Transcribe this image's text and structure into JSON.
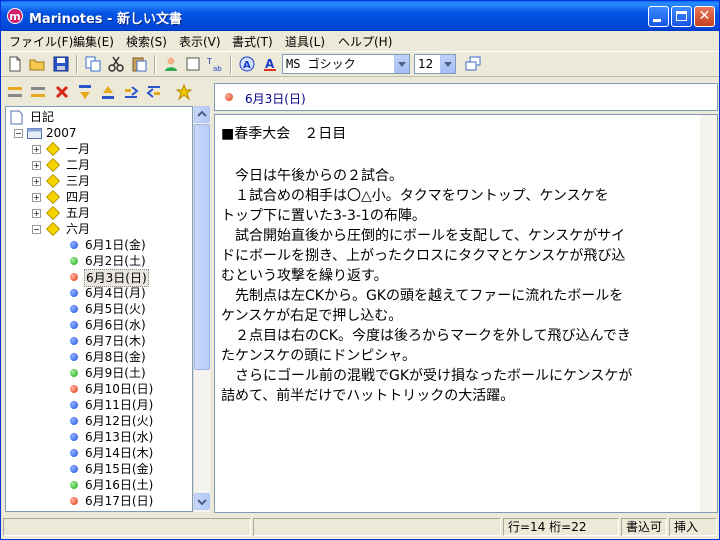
{
  "window": {
    "title": "Marinotes - 新しい文書",
    "app_icon": "m"
  },
  "menu": [
    "ファイル(F)",
    "編集(E)",
    "検索(S)",
    "表示(V)",
    "書式(T)",
    "道具(L)",
    "ヘルプ(H)"
  ],
  "toolbar": {
    "font_name": "MS ゴシック",
    "font_size": "12",
    "icons": [
      "new-document-icon",
      "open-folder-icon",
      "save-icon",
      "copy-icon",
      "cut-icon",
      "paste-icon",
      "user-icon",
      "frame-icon",
      "text-convert-icon",
      "font-color-circle-icon",
      "font-a-icon",
      "window-icon"
    ]
  },
  "tree": {
    "root": "日記",
    "year": "2007",
    "months": [
      "一月",
      "二月",
      "三月",
      "四月",
      "五月",
      "六月"
    ],
    "days": [
      {
        "label": "6月1日(金)",
        "color": "blue"
      },
      {
        "label": "6月2日(土)",
        "color": "green"
      },
      {
        "label": "6月3日(日)",
        "color": "red",
        "selected": true
      },
      {
        "label": "6月4日(月)",
        "color": "blue"
      },
      {
        "label": "6月5日(火)",
        "color": "blue"
      },
      {
        "label": "6月6日(水)",
        "color": "blue"
      },
      {
        "label": "6月7日(木)",
        "color": "blue"
      },
      {
        "label": "6月8日(金)",
        "color": "blue"
      },
      {
        "label": "6月9日(土)",
        "color": "green"
      },
      {
        "label": "6月10日(日)",
        "color": "red"
      },
      {
        "label": "6月11日(月)",
        "color": "blue"
      },
      {
        "label": "6月12日(火)",
        "color": "blue"
      },
      {
        "label": "6月13日(水)",
        "color": "blue"
      },
      {
        "label": "6月14日(木)",
        "color": "blue"
      },
      {
        "label": "6月15日(金)",
        "color": "blue"
      },
      {
        "label": "6月16日(土)",
        "color": "green"
      },
      {
        "label": "6月17日(日)",
        "color": "red"
      }
    ]
  },
  "date_header": "6月3日(日)",
  "document": {
    "title": "■春季大会　２日目",
    "lines": [
      "",
      "　今日は午後からの２試合。",
      "　１試合めの相手は〇△小。タクマをワントップ、ケンスケを",
      "トップ下に置いた3-3-1の布陣。",
      "　試合開始直後から圧倒的にボールを支配して、ケンスケがサイ",
      "ドにボールを捌き、上がったクロスにタクマとケンスケが飛び込",
      "むという攻撃を繰り返す。",
      "　先制点は左CKから。GKの頭を越えてファーに流れたボールを",
      "ケンスケが右足で押し込む。",
      "　２点目は右のCK。今度は後ろからマークを外して飛び込んでき",
      "たケンスケの頭にドンピシャ。",
      "　さらにゴール前の混戦でGKが受け損なったボールにケンスケが",
      "詰めて、前半だけでハットトリックの大活躍。"
    ]
  },
  "status": {
    "position": "行=14 桁=22",
    "mode_write": "書込可",
    "mode_insert": "挿入"
  }
}
